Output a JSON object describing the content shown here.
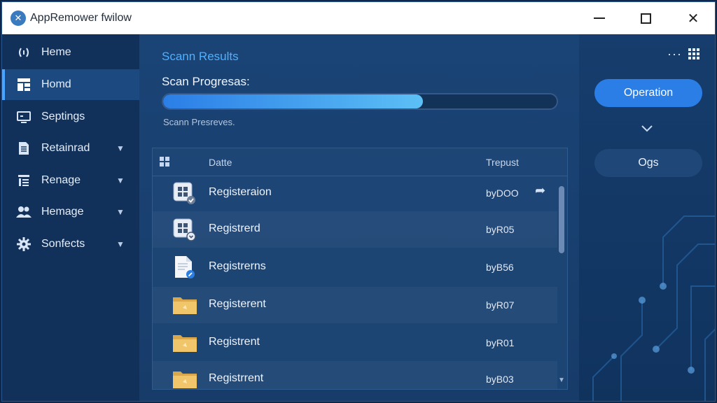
{
  "window": {
    "title": "AppRemower fwilow"
  },
  "sidebar": {
    "items": [
      {
        "label": "Heme",
        "icon": "signal-icon"
      },
      {
        "label": "Homd",
        "icon": "grid-icon"
      },
      {
        "label": "Septings",
        "icon": "settings-screen-icon"
      },
      {
        "label": "Retainrad",
        "icon": "document-icon"
      },
      {
        "label": "Renage",
        "icon": "list-icon"
      },
      {
        "label": "Hemage",
        "icon": "people-icon"
      },
      {
        "label": "Sonfects",
        "icon": "gear-icon"
      }
    ]
  },
  "main": {
    "scan_title": "Scann Results",
    "progress_label": "Scan Progresas:",
    "progress_fraction": 0.66,
    "progress_sub": "Scann Presreves.",
    "table": {
      "columns": [
        "Datte",
        "Trepust"
      ],
      "rows": [
        {
          "name": "Registeraion",
          "value": "byDOO",
          "icon": "app-grid-check-icon"
        },
        {
          "name": "Registrerd",
          "value": "byR05",
          "icon": "app-grid-down-icon"
        },
        {
          "name": "Registrerns",
          "value": "byB56",
          "icon": "document-pin-icon"
        },
        {
          "name": "Registerent",
          "value": "byR07",
          "icon": "folder-icon"
        },
        {
          "name": "Registrent",
          "value": "byR01",
          "icon": "folder-icon"
        },
        {
          "name": "Registrrent",
          "value": "byB03",
          "icon": "folder-icon"
        }
      ]
    }
  },
  "right": {
    "operation_label": "Operation",
    "ogs_label": "Ogs"
  },
  "colors": {
    "accent": "#2b7ee6",
    "title_blue": "#4fb0ff",
    "sidebar_bg": "#11315a",
    "main_bg": "#1a4476"
  }
}
